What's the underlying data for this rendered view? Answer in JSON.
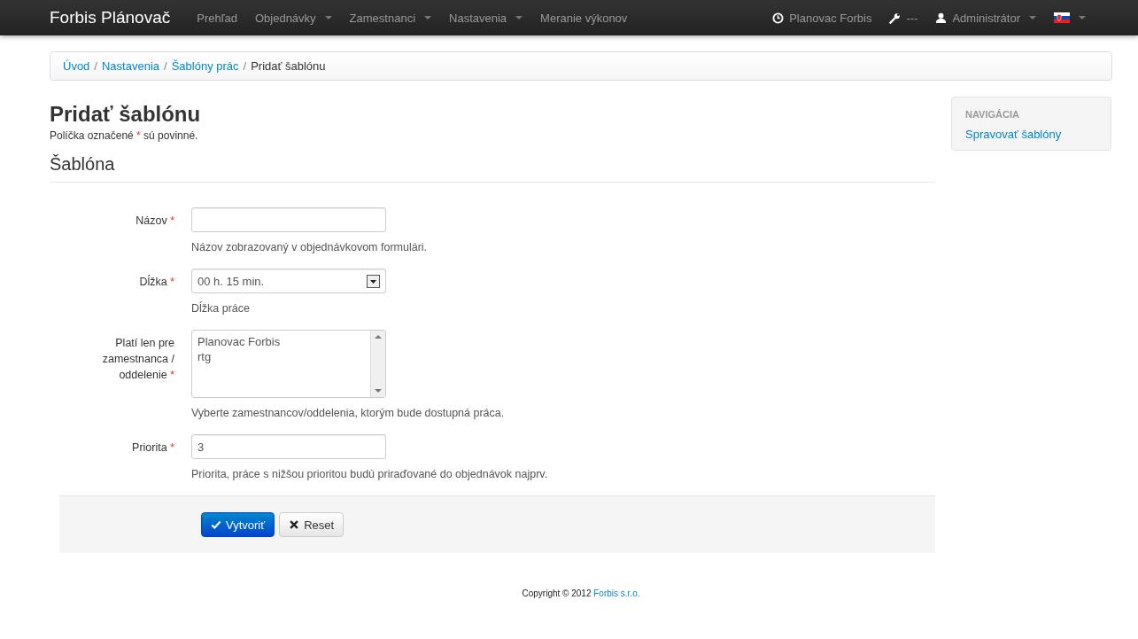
{
  "navbar": {
    "brand": "Forbis Plánovač",
    "menu": [
      {
        "label": "Prehľad",
        "dropdown": false
      },
      {
        "label": "Objednávky",
        "dropdown": true
      },
      {
        "label": "Zamestnanci",
        "dropdown": true
      },
      {
        "label": "Nastavenia",
        "dropdown": true
      },
      {
        "label": "Meranie výkonov",
        "dropdown": false
      }
    ],
    "right": [
      {
        "kind": "clock",
        "label": "Planovac Forbis",
        "dropdown": false
      },
      {
        "kind": "wrench",
        "label": "---",
        "dropdown": false
      },
      {
        "kind": "user",
        "label": "Administrátor",
        "dropdown": true
      },
      {
        "kind": "flag",
        "dropdown": true
      }
    ]
  },
  "breadcrumb": [
    {
      "label": "Úvod",
      "active": false
    },
    {
      "label": "Nastavenia",
      "active": false
    },
    {
      "label": "Šablóny prác",
      "active": false
    },
    {
      "label": "Pridať šablónu",
      "active": true
    }
  ],
  "breadcrumb_separator": "/",
  "page_title": "Pridať šablónu",
  "intro": {
    "before": "Políčka označené",
    "mark": "*",
    "after": "sú povinné."
  },
  "section_title": "Šablóna",
  "fields": [
    {
      "kind": "text",
      "label": "Názov",
      "mark": "*",
      "help": "Názov zobrazovaný v objednávkovom formulári."
    },
    {
      "kind": "select",
      "label": "Dĺžka",
      "mark": "*",
      "value": "00 h. 15 min.",
      "help": "Dĺžka práce"
    },
    {
      "kind": "multiselect",
      "label": "Platí len pre zamestnanca /",
      "label2": "oddelenie",
      "mark": "*",
      "options": [
        {
          "label": "Planovac Forbis",
          "selected": false
        },
        {
          "label": "rtg",
          "selected": false
        }
      ],
      "help": "Vyberte zamestnancov/oddelenia, ktorým bude dostupná práca."
    },
    {
      "kind": "text",
      "label": "Priorita",
      "mark": "*",
      "value": "3",
      "help": "Priorita, práce s nižšou prioritou budú priraďované do objednávok najprv."
    }
  ],
  "buttons": [
    {
      "kind": "primary",
      "label": "Vytvoriť"
    },
    {
      "kind": "default",
      "label": "Reset"
    }
  ],
  "sidebar": {
    "header": "NAVIGÁCIA",
    "links": [
      "Spravovať šablóny"
    ]
  },
  "footer": {
    "text": "Copyright © 2012",
    "link": "Forbis s.r.o."
  }
}
